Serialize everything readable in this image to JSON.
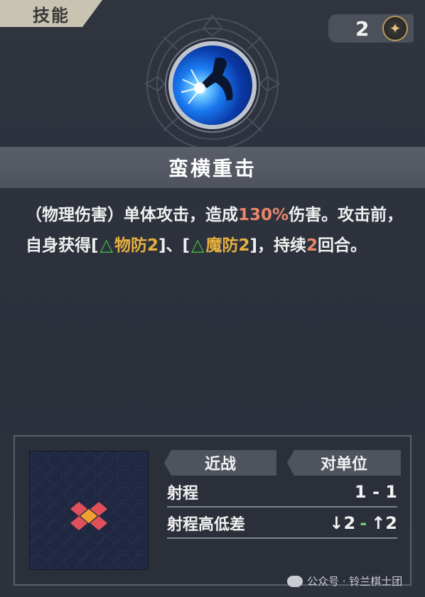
{
  "tab": {
    "label": "技能"
  },
  "cost": {
    "value": "2",
    "icon": "star-icon"
  },
  "skill": {
    "name": "蛮横重击",
    "icon": "blue-strike-icon",
    "description": {
      "p1": "（物理伤害）单体攻击，造成",
      "pct": "130%",
      "p2": "伤害。攻击前，自身获得[",
      "buff1": "物防2",
      "p3": "]、[",
      "buff2": "魔防2",
      "p4": "]，持续",
      "turns": "2",
      "p5": "回合。"
    }
  },
  "info": {
    "type_label": "近战",
    "target_label": "对单位",
    "range_label": "射程",
    "range_value": "1 - 1",
    "height_label": "射程高低差",
    "height_down": "↓2",
    "height_sep": "-",
    "height_up": "↑2"
  },
  "watermark": "公众号 · 铃兰棋士团",
  "colors": {
    "highlight_red": "#e9866a",
    "highlight_gold": "#e6b13f",
    "buff_green": "#3fbf3f",
    "range_tile_red": "#e0505a",
    "range_tile_orange": "#f0a030"
  }
}
